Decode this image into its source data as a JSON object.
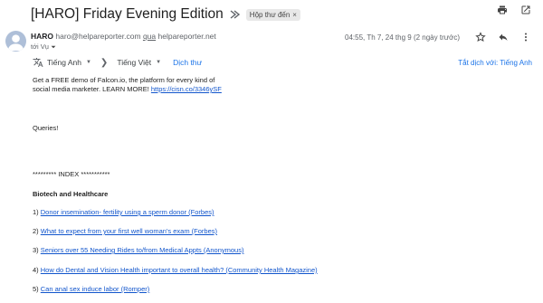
{
  "subject": "[HARO] Friday Evening Edition",
  "label_chip": "Hộp thư đến",
  "label_chip_close": "×",
  "sender": {
    "name": "HARO",
    "email": "haro@helpareporter.com",
    "via_word": "qua",
    "via_domain": "helpareporter.net",
    "to": "tới Vụ",
    "date": "04:55, Th 7, 24 thg 9 (2 ngày trước)"
  },
  "translate": {
    "from_lang": "Tiếng Anh",
    "to_lang": "Tiếng Việt",
    "translate_link": "Dịch thư",
    "turn_off": "Tắt dịch với: Tiếng Anh"
  },
  "body": {
    "line1": "Get a FREE demo of Falcon.io, the platform for every kind of",
    "line2_prefix": "social media marketer. LEARN MORE!",
    "line2_link": "https://cisn.co/3346ySF",
    "queries": "Queries!",
    "index": "********* INDEX ***********",
    "section": "Biotech and Healthcare",
    "items": [
      {
        "num": "1)",
        "text": "Donor insemination- fertility using a sperm donor (Forbes)"
      },
      {
        "num": "2)",
        "text": "What to expect from your first well woman's exam (Forbes)"
      },
      {
        "num": "3)",
        "text": "Seniors over 55 Needing Rides to/from Medical Appts (Anonymous)"
      },
      {
        "num": "4)",
        "text": "How do Dental and Vision Health important to overall health? (Community Health Magazine)"
      },
      {
        "num": "5)",
        "text": "Can anal sex induce labor (Romper)"
      }
    ]
  },
  "icons": {
    "print": "print-icon",
    "open_new": "open-in-new-window-icon",
    "star": "star-icon",
    "reply": "reply-icon",
    "more": "more-vert-icon",
    "translate": "translate-icon"
  }
}
